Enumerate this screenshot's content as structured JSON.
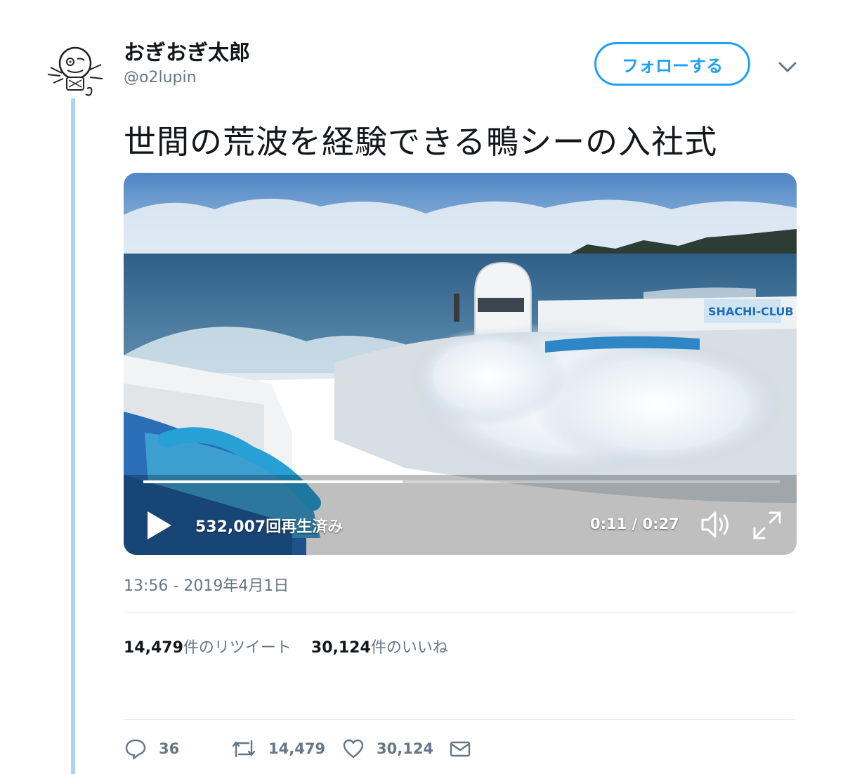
{
  "user": {
    "display_name": "おぎおぎ太郎",
    "handle": "@o2lupin"
  },
  "follow_button": {
    "label": "フォローする"
  },
  "tweet": {
    "text": "世間の荒波を経験できる鴨シーの入社式",
    "timestamp": "13:56 - 2019年4月1日"
  },
  "video": {
    "views": "532,007回再生済み",
    "time": "0:11 / 0:27",
    "progress": 0.407,
    "sign_text": "SHACHI-CLUB"
  },
  "stats": {
    "retweets_count": "14,479",
    "retweets_label": "件のリツイート",
    "likes_count": "30,124",
    "likes_label": "件のいいね"
  },
  "actions": {
    "reply_count": "36",
    "retweet_count": "14,479",
    "like_count": "30,124"
  },
  "colors": {
    "accent": "#1da1f2",
    "thread_line": "#a9d4f5",
    "muted_text": "#657786"
  },
  "icons": [
    "chevron-down-icon",
    "play-icon",
    "volume-icon",
    "fullscreen-icon",
    "reply-icon",
    "retweet-icon",
    "heart-icon",
    "dm-icon"
  ]
}
